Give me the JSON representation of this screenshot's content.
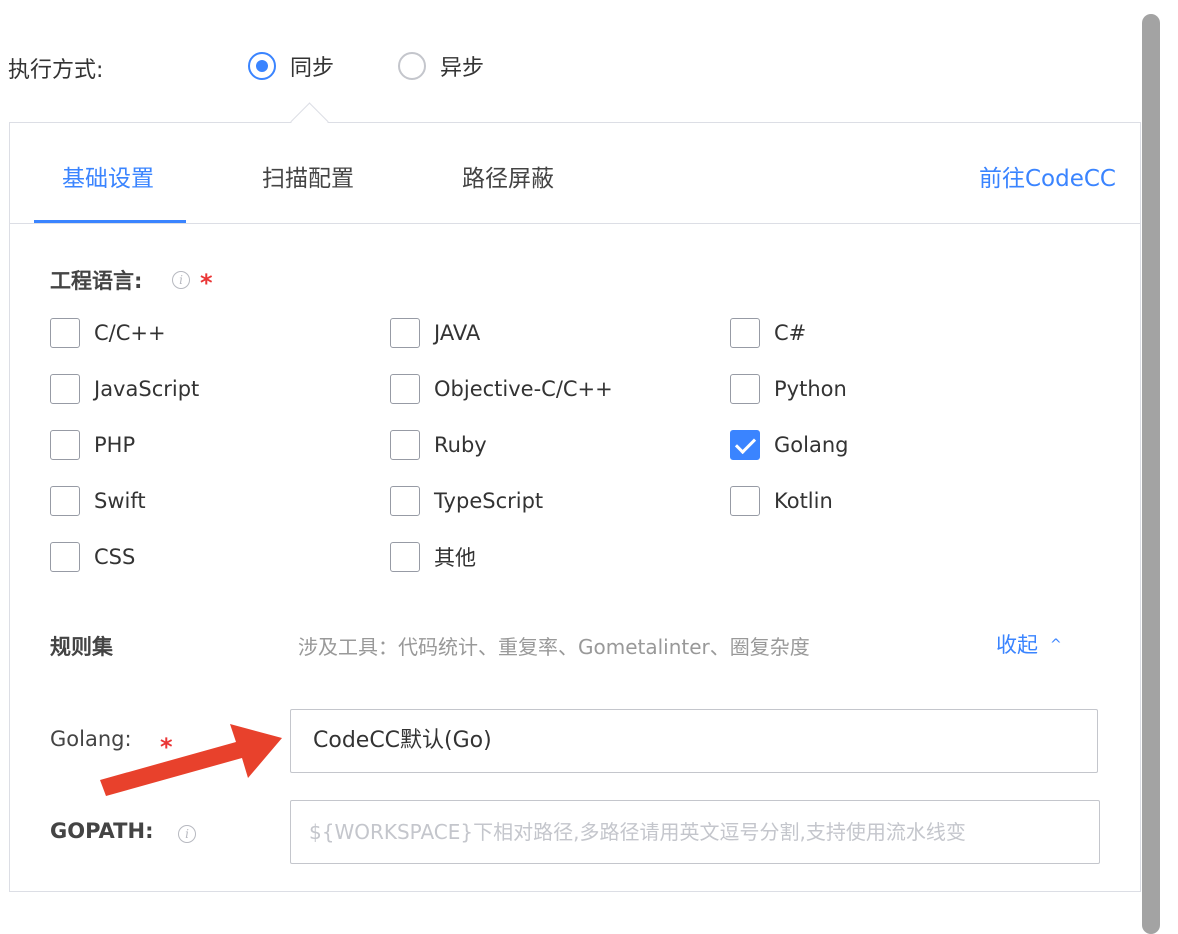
{
  "exec_mode": {
    "label": "执行方式:",
    "options": [
      {
        "label": "同步",
        "checked": true
      },
      {
        "label": "异步",
        "checked": false
      }
    ]
  },
  "tabs": {
    "items": [
      "基础设置",
      "扫描配置",
      "路径屏蔽"
    ],
    "active_index": 0,
    "link": "前往CodeCC"
  },
  "project_language": {
    "label": "工程语言:",
    "required_mark": "*",
    "options": [
      {
        "label": "C/C++",
        "checked": false
      },
      {
        "label": "JAVA",
        "checked": false
      },
      {
        "label": "C#",
        "checked": false
      },
      {
        "label": "JavaScript",
        "checked": false
      },
      {
        "label": "Objective-C/C++",
        "checked": false
      },
      {
        "label": "Python",
        "checked": false
      },
      {
        "label": "PHP",
        "checked": false
      },
      {
        "label": "Ruby",
        "checked": false
      },
      {
        "label": "Golang",
        "checked": true
      },
      {
        "label": "Swift",
        "checked": false
      },
      {
        "label": "TypeScript",
        "checked": false
      },
      {
        "label": "Kotlin",
        "checked": false
      },
      {
        "label": "CSS",
        "checked": false
      },
      {
        "label": "其他",
        "checked": false
      }
    ]
  },
  "rules": {
    "label": "规则集",
    "tools_desc": "涉及工具：代码统计、重复率、Gometalinter、圈复杂度",
    "collapse_label": "收起",
    "collapse_icon": "chevron-up-icon"
  },
  "golang_field": {
    "label": "Golang:",
    "required_mark": "*",
    "value": "CodeCC默认(Go)"
  },
  "gopath_field": {
    "label": "GOPATH:",
    "placeholder": "${WORKSPACE}下相对路径,多路径请用英文逗号分割,支持使用流水线变",
    "value": ""
  },
  "colors": {
    "accent": "#3a84ff",
    "required": "#ea3636",
    "annotation": "#e8412c"
  }
}
